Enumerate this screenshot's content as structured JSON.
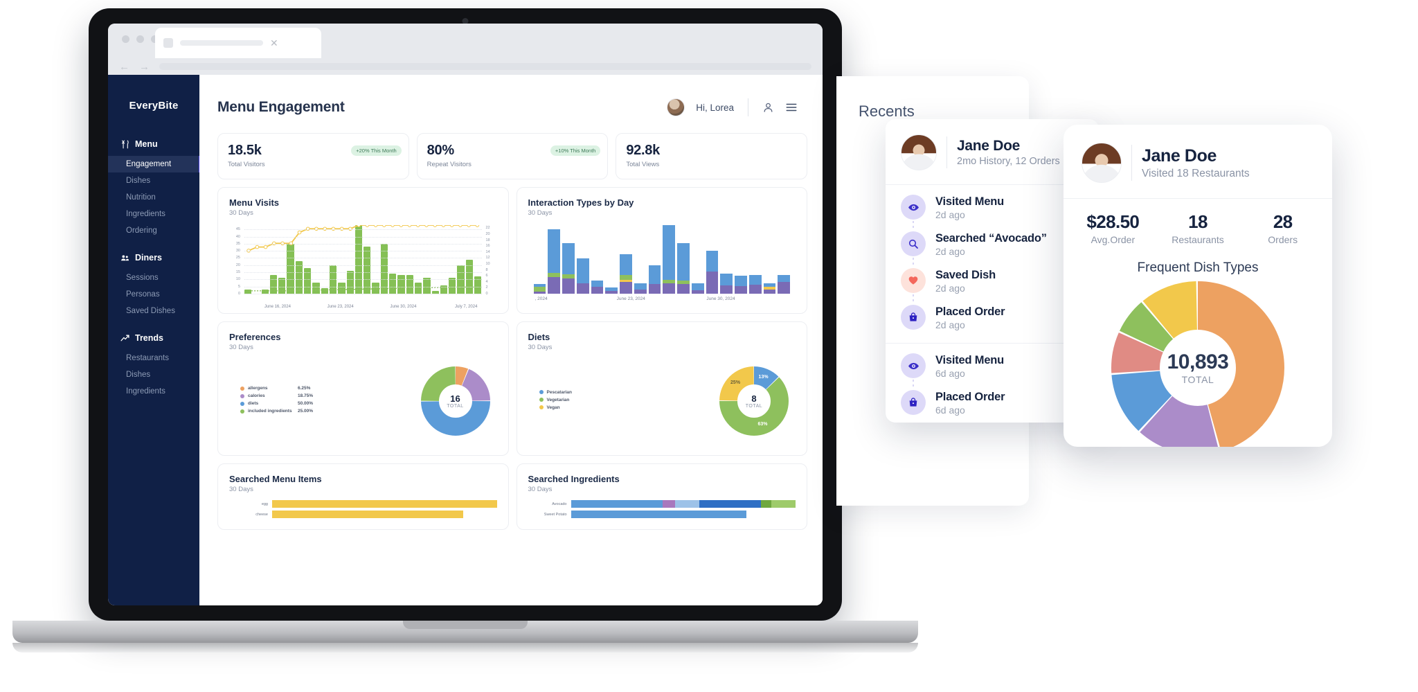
{
  "device": {
    "label": "MacBook Pro"
  },
  "browser": {
    "tab_close_icon": "close-icon"
  },
  "sidebar": {
    "brand": "EveryBite",
    "groups": [
      {
        "title": "Menu",
        "icon": "cutlery-icon",
        "items": [
          "Engagement",
          "Dishes",
          "Nutrition",
          "Ingredients",
          "Ordering"
        ],
        "active": "Engagement"
      },
      {
        "title": "Diners",
        "icon": "people-icon",
        "items": [
          "Sessions",
          "Personas",
          "Saved Dishes"
        ],
        "active": ""
      },
      {
        "title": "Trends",
        "icon": "trend-up-icon",
        "items": [
          "Restaurants",
          "Dishes",
          "Ingredients"
        ],
        "active": ""
      }
    ]
  },
  "header": {
    "title": "Menu Engagement",
    "greeting": "Hi, Lorea",
    "avatar": "user-avatar",
    "account_icon": "person-icon",
    "menu_icon": "hamburger-menu-icon"
  },
  "stats": [
    {
      "value": "18.5k",
      "label": "Total Visitors",
      "badge": "+20% This Month"
    },
    {
      "value": "80%",
      "label": "Repeat Visitors",
      "badge": "+10% This Month"
    },
    {
      "value": "92.8k",
      "label": "Total Views",
      "badge": ""
    }
  ],
  "panels": {
    "menu_visits": {
      "title": "Menu Visits",
      "subtitle": "30 Days"
    },
    "interaction": {
      "title": "Interaction Types by Day",
      "subtitle": "30 Days"
    },
    "preferences": {
      "title": "Preferences",
      "subtitle": "30 Days"
    },
    "diets": {
      "title": "Diets",
      "subtitle": "30 Days"
    },
    "searched_items": {
      "title": "Searched Menu Items",
      "subtitle": "30 Days"
    },
    "searched_ingr": {
      "title": "Searched Ingredients",
      "subtitle": "30 Days"
    }
  },
  "recents": {
    "title": "Recents",
    "person": {
      "name": "Jane Doe",
      "meta": "2mo History, 12 Orders",
      "avatar": "jane-doe-avatar"
    },
    "items": [
      {
        "action": "Visited Menu",
        "time": "2d ago",
        "icon": "eye-icon",
        "bg": "#ddd9f8",
        "fg": "#3b2fc9"
      },
      {
        "action": "Searched “Avocado”",
        "time": "2d ago",
        "icon": "search-icon",
        "bg": "#ddd9f8",
        "fg": "#3b2fc9"
      },
      {
        "action": "Saved Dish",
        "time": "2d ago",
        "icon": "heart-icon",
        "bg": "#fde2db",
        "fg": "#f4675c"
      },
      {
        "action": "Placed Order",
        "time": "2d ago",
        "icon": "shopping-bag-icon",
        "bg": "#ddd9f8",
        "fg": "#2d21c2"
      },
      {
        "action": "Visited Menu",
        "time": "6d ago",
        "icon": "eye-icon",
        "bg": "#ddd9f8",
        "fg": "#3b2fc9"
      },
      {
        "action": "Placed Order",
        "time": "6d ago",
        "icon": "shopping-bag-icon",
        "bg": "#ddd9f8",
        "fg": "#2d21c2"
      }
    ],
    "separator_after_index": 3
  },
  "phone": {
    "person": {
      "name": "Jane Doe",
      "meta": "Visited 18 Restaurants",
      "avatar": "jane-doe-avatar"
    },
    "stats": [
      {
        "value": "$28.50",
        "label": "Avg.Order"
      },
      {
        "value": "18",
        "label": "Restaurants"
      },
      {
        "value": "28",
        "label": "Orders"
      }
    ],
    "chart_title": "Frequent Dish Types",
    "center_value": "10,893",
    "center_label": "TOTAL"
  },
  "colors": {
    "sidebar_bg": "#102046",
    "accent_indigo": "#4f46e5",
    "green": "#85c055",
    "yellow": "#f2c84b",
    "blue": "#5b9bd8",
    "purple": "#ab8cc9",
    "orange": "#eda161",
    "red": "#e08b84",
    "badge_bg": "#dcf2e3",
    "badge_fg": "#3e7a58"
  },
  "chart_data": [
    {
      "type": "bar",
      "id": "menu-visits",
      "title": "Menu Visits",
      "subtitle": "30 Days",
      "xlabel": "",
      "ylabel": "",
      "ylim": [
        0,
        48
      ],
      "y2lim": [
        0,
        23
      ],
      "yticks": [
        0,
        5,
        10,
        15,
        20,
        25,
        30,
        35,
        40,
        45
      ],
      "y2ticks": [
        0,
        2,
        4,
        6,
        8,
        10,
        12,
        14,
        16,
        18,
        20,
        22
      ],
      "tick_labels_x": [
        "June 16, 2024",
        "June 23, 2024",
        "June 30, 2024",
        "July 7, 2024"
      ],
      "grid": true,
      "values": [
        3,
        0,
        3,
        13,
        11,
        35,
        23,
        18,
        8,
        4,
        20,
        8,
        16,
        48,
        33,
        8,
        35,
        14,
        13,
        13,
        8,
        11,
        2,
        6,
        11,
        20,
        24,
        12
      ],
      "series": [
        {
          "name": "visits-bars",
          "type": "bar",
          "color": "#85c055",
          "values": [
            3,
            0,
            3,
            13,
            11,
            35,
            23,
            18,
            8,
            4,
            20,
            8,
            16,
            48,
            33,
            8,
            35,
            14,
            13,
            13,
            8,
            11,
            2,
            6,
            11,
            20,
            24,
            12
          ]
        },
        {
          "name": "cumulative-line",
          "type": "line",
          "color": "#f2c84b",
          "axis": "right",
          "values": [
            16,
            17,
            17,
            18,
            18,
            18,
            21,
            22,
            22,
            22,
            22,
            22,
            22,
            23,
            23,
            23,
            23,
            23,
            23,
            23,
            23,
            23,
            23,
            23,
            23,
            23,
            23,
            23
          ]
        },
        {
          "name": "avg-dashed",
          "type": "line",
          "color": "#8ec05d",
          "dash": true,
          "axis": "right",
          "values": [
            5,
            5,
            5,
            5,
            5,
            5,
            5.1,
            5.2,
            5.2,
            5.2,
            5.3,
            5.3,
            5.4,
            5.4,
            5.5,
            5.5,
            5.6,
            5.6,
            5.7,
            5.7,
            5.8,
            5.8,
            5.9,
            5.9,
            6,
            6,
            6,
            6
          ]
        }
      ]
    },
    {
      "type": "bar",
      "id": "interaction-types",
      "title": "Interaction Types by Day",
      "subtitle": "30 Days",
      "stacked": true,
      "tick_labels_x": [
        ", 2024",
        "June 23, 2024",
        "June 30, 2024"
      ],
      "grid": true,
      "series": [
        {
          "name": "purple",
          "color": "#7a6bb5",
          "values": [
            3,
            22,
            20,
            14,
            9,
            4,
            16,
            6,
            13,
            14,
            13,
            5,
            30,
            11,
            10,
            12,
            6,
            16
          ]
        },
        {
          "name": "yellow",
          "color": "#f2c84b",
          "values": [
            0,
            0,
            0,
            0,
            0,
            0,
            3,
            0,
            0,
            0,
            0,
            0,
            0,
            0,
            0,
            0,
            3,
            0
          ]
        },
        {
          "name": "green",
          "color": "#8ec05d",
          "values": [
            6,
            6,
            6,
            0,
            0,
            0,
            6,
            0,
            0,
            5,
            5,
            0,
            0,
            0,
            0,
            0,
            0,
            0
          ]
        },
        {
          "name": "blue",
          "color": "#5b9bd8",
          "values": [
            4,
            58,
            42,
            33,
            9,
            4,
            28,
            8,
            25,
            73,
            50,
            9,
            28,
            16,
            14,
            13,
            5,
            9
          ]
        }
      ]
    },
    {
      "type": "pie",
      "id": "preferences",
      "title": "Preferences",
      "subtitle": "30 Days",
      "center_value": "16",
      "center_label": "TOTAL",
      "legend_position": "left",
      "labels": [
        "allergens",
        "calories",
        "diets",
        "included ingredients"
      ],
      "values": [
        6.25,
        18.75,
        50.0,
        25.0
      ],
      "value_labels": [
        "6.25%",
        "18.75%",
        "50.00%",
        "25.00%"
      ],
      "colors": [
        "#eda161",
        "#ab8cc9",
        "#5b9bd8",
        "#8ec05d"
      ]
    },
    {
      "type": "pie",
      "id": "diets",
      "title": "Diets",
      "subtitle": "30 Days",
      "center_value": "8",
      "center_label": "TOTAL",
      "legend_position": "left",
      "labels": [
        "Pescatarian",
        "Vegetarian",
        "Vegan"
      ],
      "values": [
        13,
        63,
        25
      ],
      "value_labels": [
        "13%",
        "63%",
        "25%"
      ],
      "colors": [
        "#5b9bd8",
        "#8ec05d",
        "#f2c84b"
      ]
    },
    {
      "type": "bar",
      "id": "searched-menu-items",
      "title": "Searched Menu Items",
      "subtitle": "30 Days",
      "orientation": "horizontal",
      "categories": [
        "egg",
        "cheese"
      ],
      "values": [
        100,
        85
      ],
      "colors": [
        "#f2c84b",
        "#f2c84b"
      ]
    },
    {
      "type": "bar",
      "id": "searched-ingredients",
      "title": "Searched Ingredients",
      "subtitle": "30 Days",
      "orientation": "horizontal",
      "stacked": true,
      "categories": [
        "Avocado",
        "Sweet Potato"
      ],
      "series": [
        {
          "name": "blue-light",
          "color": "#5b9bd8",
          "values": [
            45,
            78
          ]
        },
        {
          "name": "purple",
          "color": "#a878bd",
          "values": [
            6,
            0
          ]
        },
        {
          "name": "pale-blue",
          "color": "#9dc2e8",
          "values": [
            12,
            0
          ]
        },
        {
          "name": "blue-dark",
          "color": "#2f6fc4",
          "values": [
            30,
            0
          ]
        },
        {
          "name": "green",
          "color": "#6fa83f",
          "values": [
            5,
            0
          ]
        },
        {
          "name": "green-light",
          "color": "#9ecb6a",
          "values": [
            12,
            0
          ]
        }
      ]
    },
    {
      "type": "pie",
      "id": "frequent-dish-types",
      "title": "Frequent Dish Types",
      "center_value": "10,893",
      "center_label": "TOTAL",
      "values": [
        46,
        16,
        12,
        8,
        7,
        11
      ],
      "colors": [
        "#eda161",
        "#ab8cc9",
        "#5b9bd8",
        "#e08b84",
        "#8ec05d",
        "#f2c84b"
      ]
    }
  ]
}
